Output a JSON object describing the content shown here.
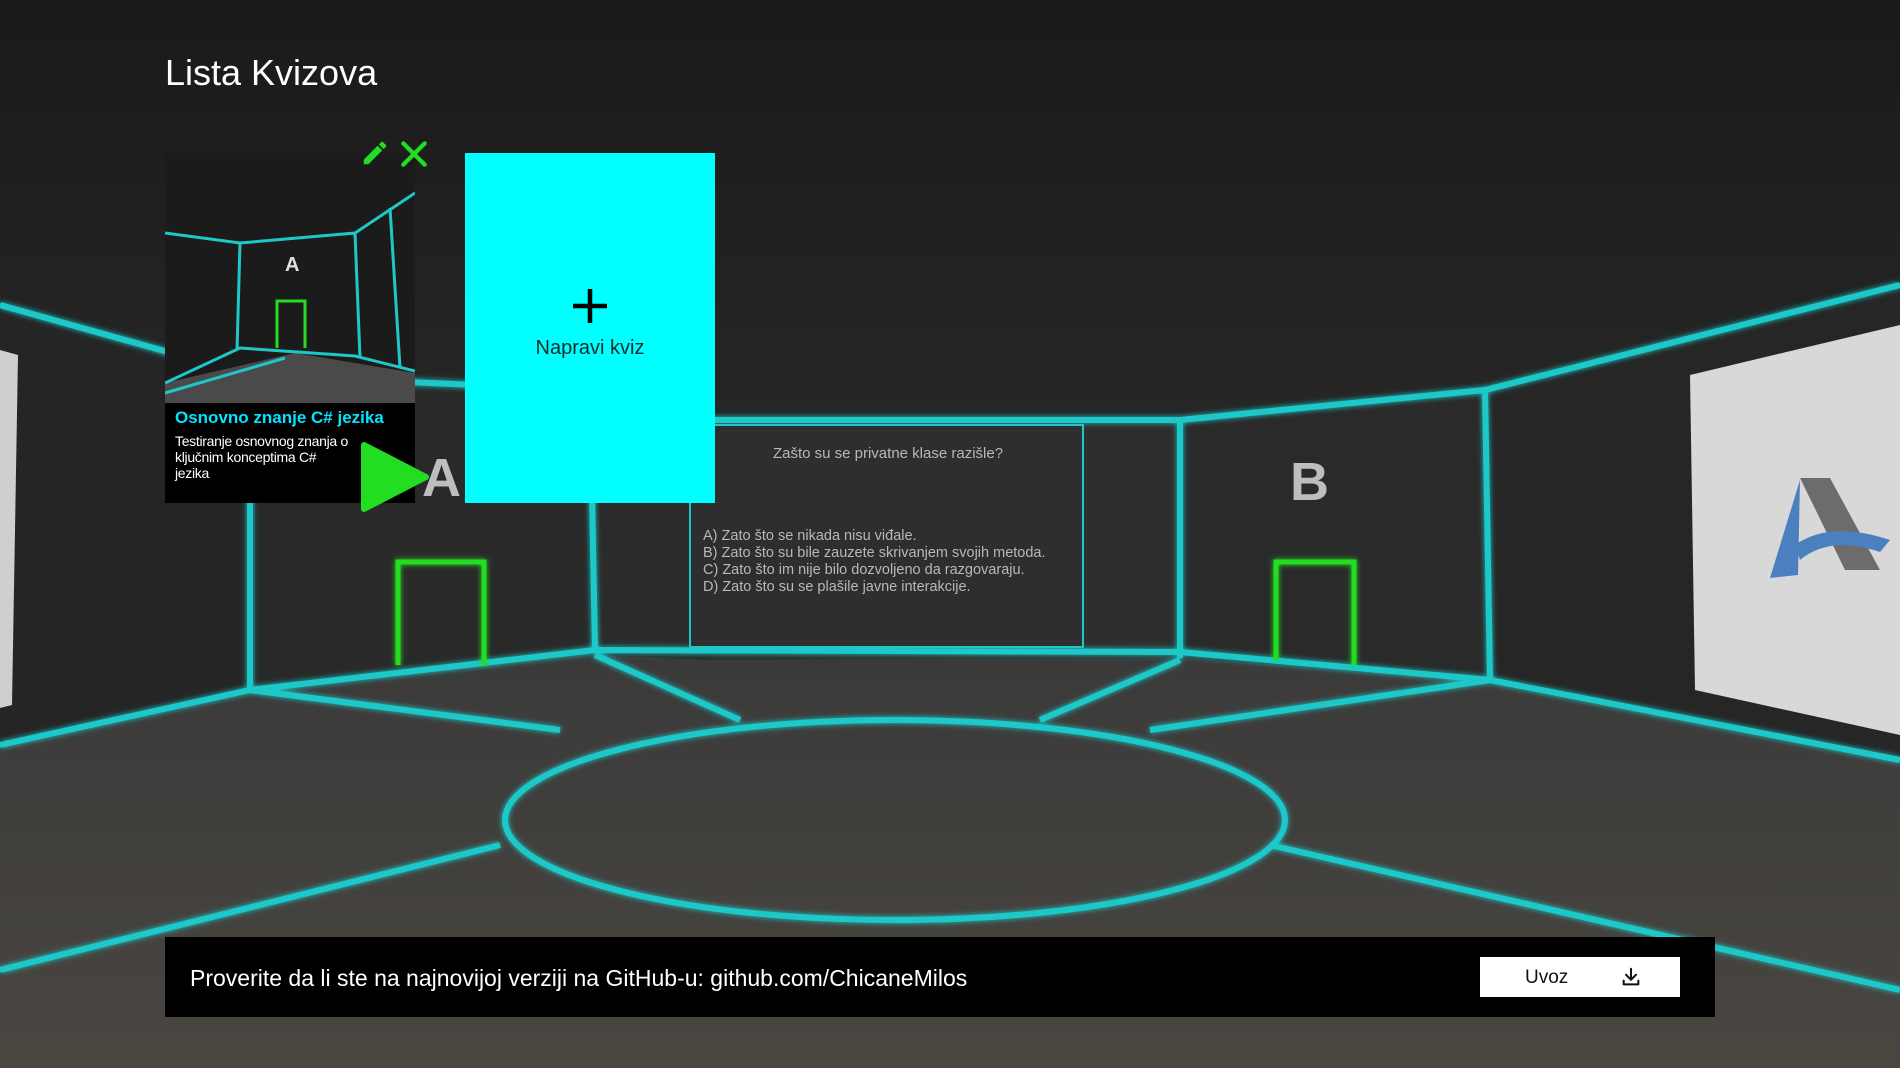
{
  "header": {
    "title": "Lista Kvizova"
  },
  "quizzes": [
    {
      "name": "Osnovno znanje C# jezika",
      "description": "Testiranje osnovnog znanja o ključnim konceptima C# jezika",
      "thumbnail_letter": "A"
    }
  ],
  "create_card": {
    "label": "Napravi kviz"
  },
  "scene": {
    "question": "Zašto su se privatne klase razišle?",
    "answers": [
      "A) Zato što se nikada nisu viđale.",
      "B) Zato što su bile zauzete skrivanjem svojih metoda.",
      "C) Zato što im nije bilo dozvoljeno da razgovaraju.",
      "D) Zato što su se plašile javne interakcije."
    ],
    "door_labels": [
      "A",
      "B"
    ]
  },
  "footer": {
    "message": "Proverite da li ste na najnovijoj verziji na GitHub-u: github.com/ChicaneMilos",
    "import_label": "Uvoz"
  },
  "colors": {
    "neon_cyan": "#1fc8c8",
    "neon_green": "#22dd22",
    "accent_cyan": "#00ffff",
    "title_cyan": "#00e5ff"
  },
  "icons": {
    "edit": "pencil-icon",
    "delete": "close-icon",
    "play": "play-icon",
    "create": "plus-icon",
    "import": "download-icon"
  }
}
